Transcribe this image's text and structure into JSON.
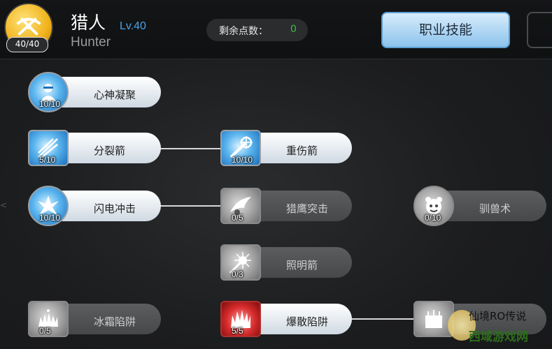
{
  "header": {
    "skill_points_badge": "40/40",
    "job_name": "猎人",
    "job_level": "Lv.40",
    "job_name_en": "Hunter",
    "remaining_points_label": "剩余点数：",
    "remaining_points_value": "0",
    "job_skills_button": "职业技能"
  },
  "skills": [
    {
      "name": "心神凝聚",
      "level": "10/10",
      "icon": "meditation-icon"
    },
    {
      "name": "分裂箭",
      "level": "5/10",
      "icon": "split-arrow-icon"
    },
    {
      "name": "重伤箭",
      "level": "10/10",
      "icon": "heavy-arrow-icon"
    },
    {
      "name": "闪电冲击",
      "level": "10/10",
      "icon": "lightning-burst-icon"
    },
    {
      "name": "猎鹰突击",
      "level": "0/5",
      "icon": "falcon-strike-icon"
    },
    {
      "name": "驯兽术",
      "level": "0/10",
      "icon": "beast-taming-icon"
    },
    {
      "name": "照明箭",
      "level": "0/3",
      "icon": "flare-arrow-icon"
    },
    {
      "name": "冰霜陷阱",
      "level": "0/5",
      "icon": "frost-trap-icon"
    },
    {
      "name": "爆散陷阱",
      "level": "5/5",
      "icon": "blast-trap-icon"
    },
    {
      "name": "",
      "level": "",
      "icon": "tnt-trap-icon"
    }
  ],
  "edge_mark": "<",
  "watermark": {
    "line1": "仙境RO传说",
    "line2": "西域游戏网"
  },
  "colors": {
    "accent_blue": "#4aa3e8",
    "points_green": "#3fbf3f",
    "button_blue": "#8cc3ec"
  }
}
